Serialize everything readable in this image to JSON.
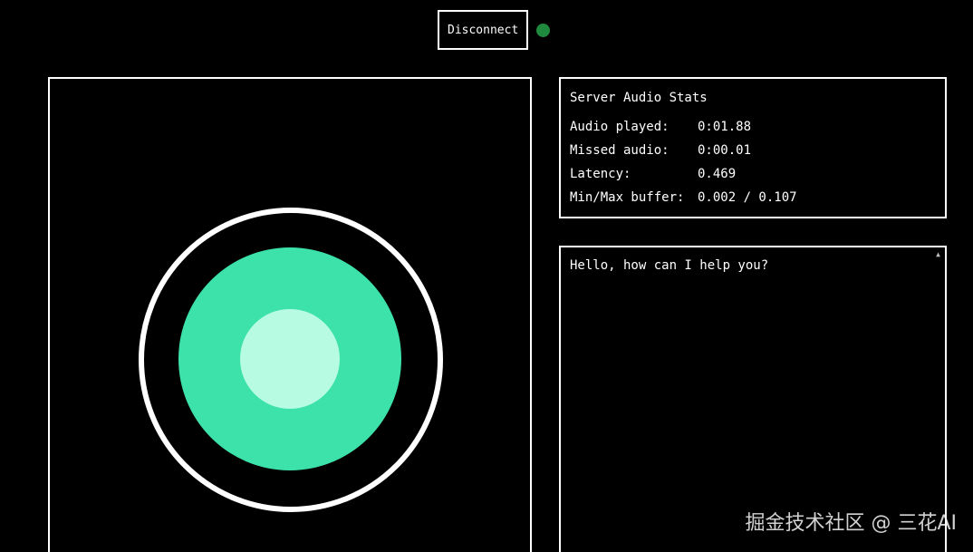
{
  "header": {
    "disconnect_label": "Disconnect",
    "status_color": "#1f8a3e"
  },
  "visualizer": {
    "ring_color": "#ffffff",
    "mid_color": "#3de2ab",
    "inner_color": "#b8fbe3"
  },
  "stats": {
    "title": "Server Audio Stats",
    "rows": [
      {
        "label": "Audio played:",
        "value": "0:01.88"
      },
      {
        "label": "Missed audio:",
        "value": "0:00.01"
      },
      {
        "label": "Latency:",
        "value": "0.469"
      },
      {
        "label": "Min/Max buffer:",
        "value": "0.002 / 0.107"
      }
    ]
  },
  "transcript": {
    "message": "Hello, how can I help you?",
    "scroll_icon": "triangle-up-icon"
  },
  "watermark": {
    "text": "掘金技术社区 @ 三花AI"
  }
}
